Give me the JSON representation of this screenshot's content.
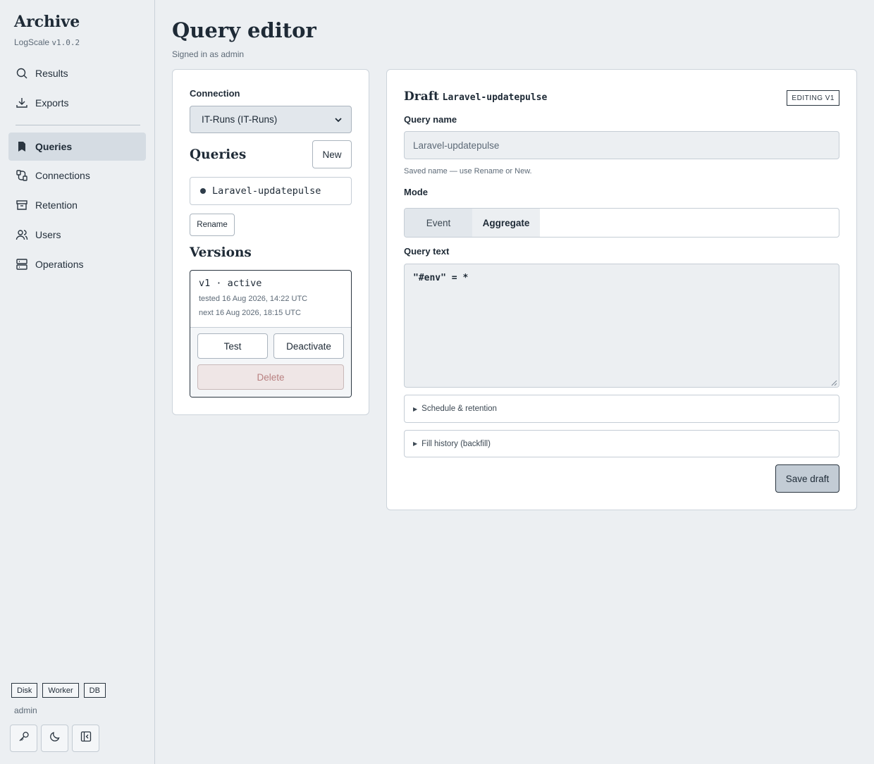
{
  "sidebar": {
    "app_name": "Archive",
    "app_sub": "LogScale",
    "version": "v1.0.2",
    "nav": [
      {
        "label": "Results",
        "icon": "search-icon"
      },
      {
        "label": "Exports",
        "icon": "download-icon"
      },
      {
        "label": "Queries",
        "icon": "bookmark-icon",
        "active": true
      },
      {
        "label": "Connections",
        "icon": "plug-icon"
      },
      {
        "label": "Retention",
        "icon": "archive-icon"
      },
      {
        "label": "Users",
        "icon": "users-icon"
      },
      {
        "label": "Operations",
        "icon": "server-icon"
      }
    ],
    "status_badges": [
      "Disk",
      "Worker",
      "DB"
    ],
    "user": "admin"
  },
  "header": {
    "title": "Query editor",
    "subtitle": "Signed in as admin"
  },
  "left_panel": {
    "connection_label": "Connection",
    "connection_value": "IT-Runs (IT-Runs)",
    "queries_heading": "Queries",
    "new_label": "New",
    "query_item": "Laravel-updatepulse",
    "rename_label": "Rename",
    "versions_heading": "Versions",
    "version": {
      "title": "v1 · active",
      "tested": "tested 16 Aug 2026, 14:22 UTC",
      "next": "next 16 Aug 2026, 18:15 UTC",
      "test_label": "Test",
      "deactivate_label": "Deactivate",
      "delete_label": "Delete"
    }
  },
  "draft": {
    "title_prefix": "Draft",
    "title_name": "Laravel-updatepulse",
    "badge": "EDITING V1",
    "query_name_label": "Query name",
    "query_name_value": "Laravel-updatepulse",
    "query_name_hint": "Saved name — use Rename or New.",
    "mode_label": "Mode",
    "mode_event": "Event",
    "mode_aggregate": "Aggregate",
    "query_text_label": "Query text",
    "query_text": "\"#env\" = *",
    "schedule_label": "Schedule & retention",
    "backfill_label": "Fill history (backfill)",
    "save_label": "Save draft"
  }
}
